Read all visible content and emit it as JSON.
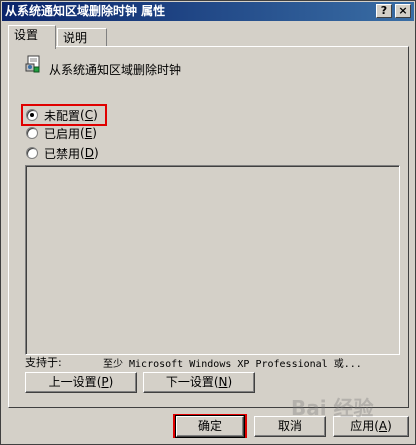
{
  "window": {
    "title": "从系统通知区域删除时钟 属性",
    "help_glyph": "?",
    "close_glyph": "×"
  },
  "tabs": [
    {
      "label": "设置"
    },
    {
      "label": "说明"
    }
  ],
  "policy": {
    "icon": "policy-settings-icon",
    "title": "从系统通知区域删除时钟"
  },
  "options": [
    {
      "label": "未配置",
      "hotkey": "C",
      "selected": true
    },
    {
      "label": "已启用",
      "hotkey": "E",
      "selected": false
    },
    {
      "label": "已禁用",
      "hotkey": "D",
      "selected": false
    }
  ],
  "supported": {
    "label": "支持于:",
    "value": "至少 Microsoft Windows XP Professional 或..."
  },
  "nav": {
    "prev_label": "上一设置",
    "prev_hotkey": "P",
    "next_label": "下一设置",
    "next_hotkey": "N"
  },
  "footer": {
    "ok_label": "确定",
    "cancel_label": "取消",
    "apply_label": "应用",
    "apply_hotkey": "A"
  },
  "colors": {
    "titlebar_start": "#0a246a",
    "titlebar_end": "#3a6ea5",
    "face": "#d4d0c8",
    "highlight": "#e00000"
  }
}
